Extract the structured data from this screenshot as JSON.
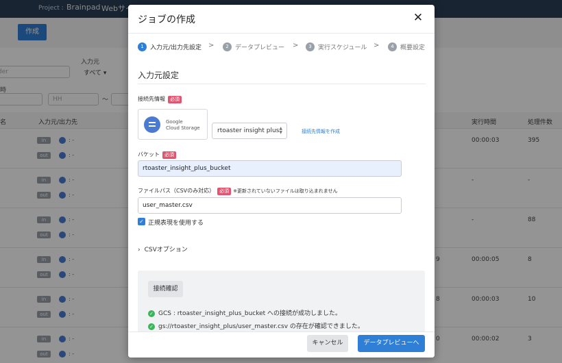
{
  "background": {
    "project_label": "Project :",
    "project_name": "Brainpad",
    "site_name": "Webサイ",
    "create_button": "作成",
    "filter_placeholder": "der",
    "input_source_label": "入力元",
    "input_source_value": "すべて",
    "time_label": "時",
    "hh_placeholder": "HH",
    "range_sep": "〜",
    "columns": {
      "name": "名",
      "io": "入力元/出力先",
      "exec_time": "実行時間",
      "processed": "処理件数"
    },
    "rows": [
      {
        "exec_time": "00:00:03",
        "processed": "395",
        "extra": ""
      },
      {
        "exec_time": "-",
        "processed": "-",
        "extra": ""
      },
      {
        "exec_time": "-",
        "processed": "88",
        "extra": ""
      },
      {
        "exec_time": "00:00:05",
        "processed": "8",
        "extra": "9"
      },
      {
        "exec_time": "00:00:03",
        "processed": "10",
        "extra": "8"
      },
      {
        "exec_time": "00:00:02",
        "processed": "3",
        "extra": "0"
      }
    ],
    "badge_in": "in",
    "badge_out": "out",
    "row_dash": ": -"
  },
  "modal": {
    "title": "ジョブの作成",
    "close_symbol": "✕",
    "steps": [
      {
        "num": "1",
        "label": "入力元/出力先設定"
      },
      {
        "num": "2",
        "label": "データプレビュー"
      },
      {
        "num": "3",
        "label": "実行スケジュール"
      },
      {
        "num": "4",
        "label": "概要設定"
      }
    ],
    "step_sep": ">",
    "section_title": "入力元設定",
    "connection_label": "接続先情報",
    "required": "必須",
    "gcs_line1": "Google",
    "gcs_line2": "Cloud Storage",
    "connection_value": "rtoaster insight plus",
    "create_connection_link": "接続先情報を作成",
    "bucket_label": "バケット",
    "bucket_value": "rtoaster_insight_plus_bucket",
    "filepath_label": "ファイルパス（CSVのみ対応）",
    "filepath_note": "※更新されていないファイルは取り込まれません",
    "filepath_value": "user_master.csv",
    "regex_label": "正規表現を使用する",
    "csv_options": "CSVオプション",
    "test_button": "接続確認",
    "messages": [
      "GCS : rtoaster_insight_plus_bucket への接続が成功しました。",
      "gs://rtoaster_insight_plus/user_master.csv の存在が確認できました。"
    ],
    "cancel_button": "キャンセル",
    "next_button": "データプレビューへ"
  },
  "colors": {
    "primary": "#2f7fd6",
    "required": "#e05570",
    "success": "#3cb45c"
  }
}
